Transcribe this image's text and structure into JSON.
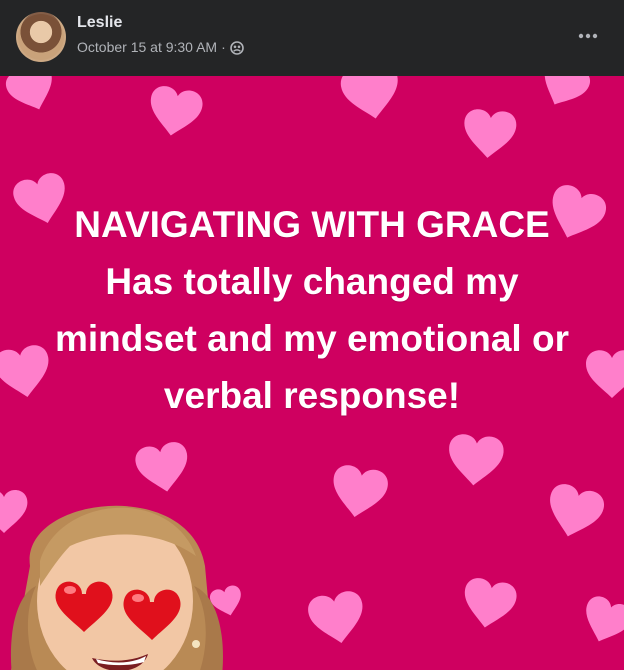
{
  "post": {
    "author": "Leslie",
    "timestamp": "October 15 at 9:30 AM",
    "separator": "·",
    "audience_icon": "friends-icon",
    "more_icon": "more-horizontal-icon"
  },
  "image": {
    "background_color": "#cf0060",
    "heart_colors": [
      "#ff6fc2",
      "#ff9ad6"
    ],
    "lines": [
      "NAVIGATING WITH GRACE",
      "Has totally changed my",
      "mindset and my emotional or",
      "verbal response!"
    ],
    "sticker": "heart-eyes-memoji"
  }
}
